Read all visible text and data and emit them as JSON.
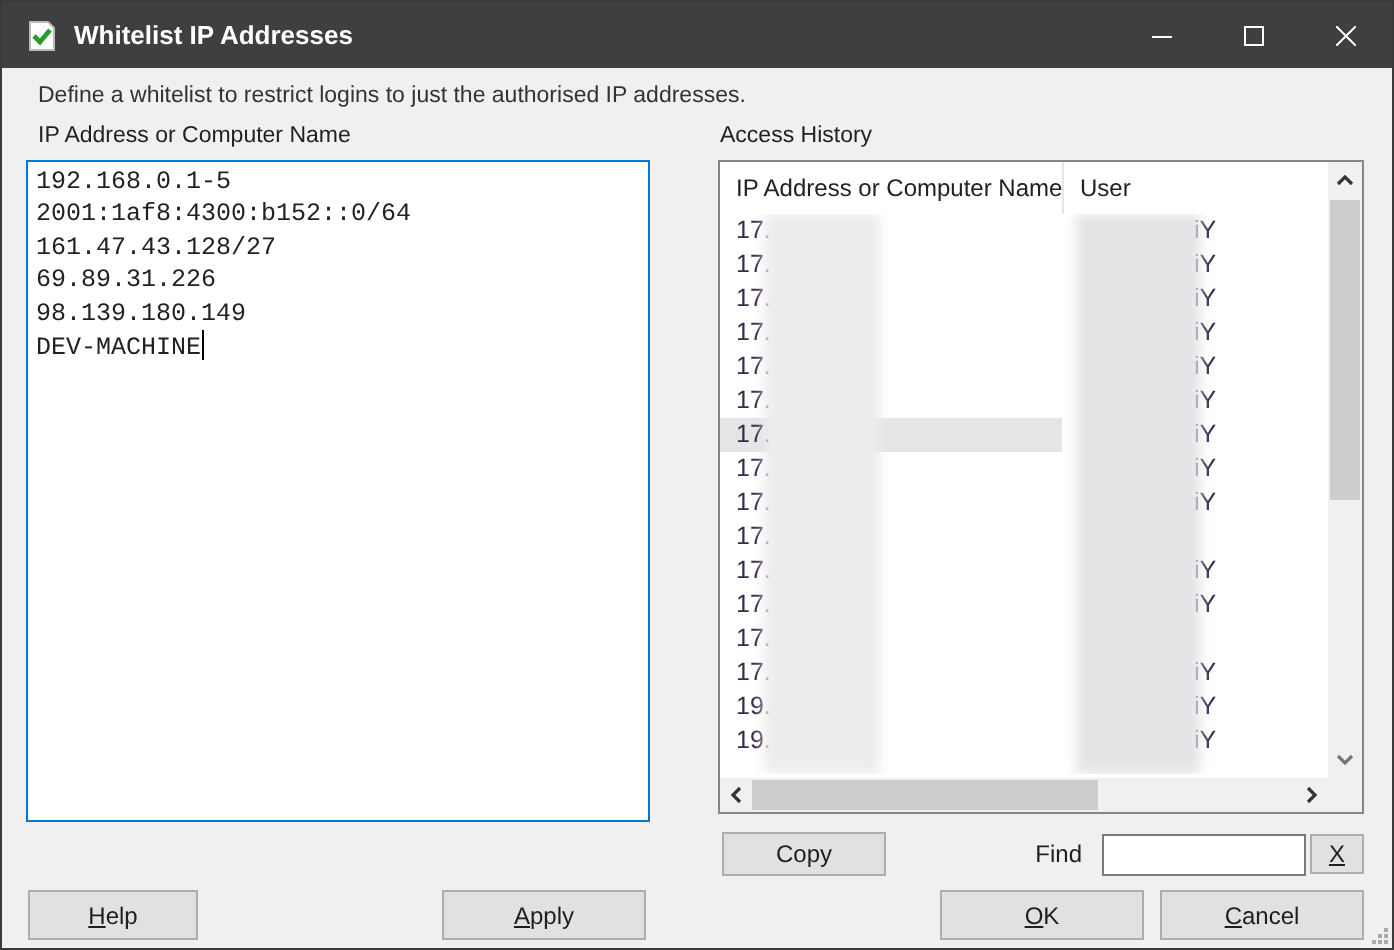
{
  "window": {
    "title": "Whitelist IP Addresses"
  },
  "description": "Define a whitelist to restrict logins to just the authorised IP addresses.",
  "whitelist": {
    "label": "IP Address or Computer Name",
    "focused": true,
    "lines": [
      "192.168.0.1-5",
      "2001:1af8:4300:b152::0/64",
      "161.47.43.128/27",
      "69.89.31.226",
      "98.139.180.149",
      "DEV-MACHINE"
    ]
  },
  "access_history": {
    "label": "Access History",
    "columns": [
      "IP Address or Computer Name",
      "User"
    ],
    "rows": [
      {
        "ip": "17.",
        "user": "iY",
        "selected": false
      },
      {
        "ip": "17.",
        "user": "iY",
        "selected": false
      },
      {
        "ip": "17.",
        "user": "iY",
        "selected": false
      },
      {
        "ip": "17.",
        "user": "iY",
        "selected": false
      },
      {
        "ip": "17.",
        "user": "iY",
        "selected": false
      },
      {
        "ip": "17.",
        "user": "iY",
        "selected": false
      },
      {
        "ip": "17.",
        "user": "iY",
        "selected": true
      },
      {
        "ip": "17.",
        "user": "iY",
        "selected": false
      },
      {
        "ip": "17.",
        "user": "iY",
        "selected": false
      },
      {
        "ip": "17.",
        "selected": false
      },
      {
        "ip": "17.",
        "user": "iY",
        "selected": false
      },
      {
        "ip": "17.",
        "user": "iY",
        "selected": false
      },
      {
        "ip": "17.",
        "selected": false
      },
      {
        "ip": "17.",
        "user": "iY",
        "selected": false
      },
      {
        "ip": "19.",
        "user": "iY",
        "selected": false
      },
      {
        "ip": "19.",
        "user": "iY",
        "selected": false
      }
    ]
  },
  "copy_button": {
    "label": "Copy",
    "mnemonic": false
  },
  "find": {
    "label": "Find",
    "clear_button": {
      "label": "X",
      "mnemonic": true
    }
  },
  "buttons": [
    {
      "label": "Help",
      "mnemonic": true
    },
    {
      "label": "Apply",
      "mnemonic": true
    },
    {
      "label": "OK",
      "mnemonic": true
    },
    {
      "label": "Cancel",
      "mnemonic": true
    }
  ]
}
